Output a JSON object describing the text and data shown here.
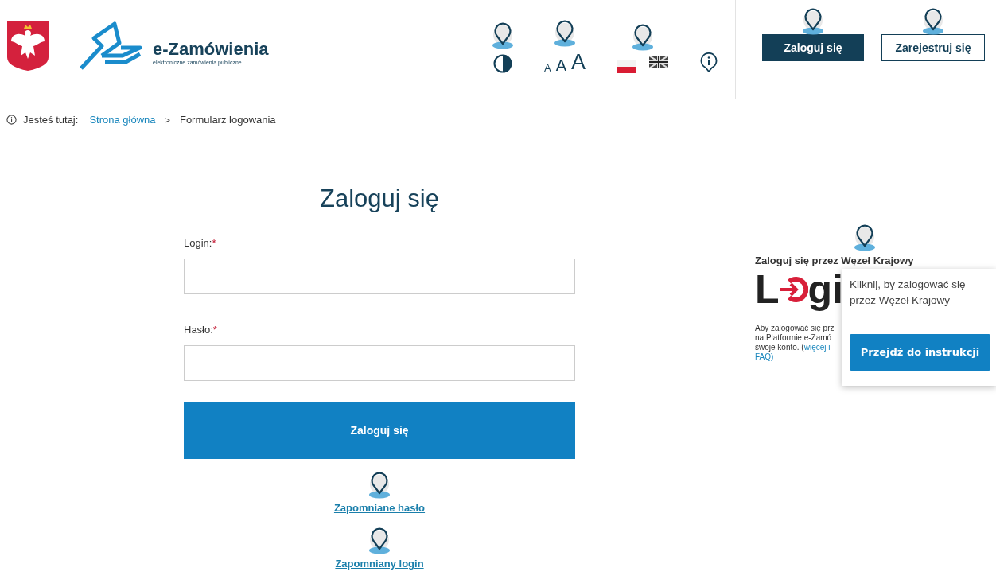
{
  "header": {
    "logo_title": "e-Zamówienia",
    "logo_subtitle": "elektroniczne zamówienia publiczne",
    "font_sizes": [
      "A",
      "A",
      "A"
    ],
    "languages": [
      {
        "kind": "pl"
      },
      {
        "kind": "en"
      }
    ],
    "buttons": [
      {
        "label": "Zaloguj się",
        "kind": "primary"
      },
      {
        "label": "Zarejestruj się",
        "kind": "outline"
      }
    ]
  },
  "breadcrumb": {
    "label": "Jesteś tutaj:",
    "separator": ">",
    "items": [
      {
        "label": "Strona główna",
        "kind": "link"
      },
      {
        "label": "Formularz logowania",
        "kind": "current"
      }
    ]
  },
  "form": {
    "title": "Zaloguj się",
    "fields": [
      {
        "label": "Login:",
        "required_mark": "*"
      },
      {
        "label": "Hasło:",
        "required_mark": "*"
      }
    ],
    "submit": "Zaloguj się",
    "links": [
      "Zapomniane hasło",
      "Zapomniany login"
    ]
  },
  "side": {
    "title": "Zaloguj się przez Węzeł Krajowy",
    "logo": {
      "before": "L",
      "after": "gi"
    },
    "lines": [
      [
        {
          "kind": "text",
          "text": "Aby zalogować się prz"
        }
      ],
      [
        {
          "kind": "text",
          "text": "na Platformie e-Zamó"
        }
      ],
      [
        {
          "kind": "text",
          "text": "swoje konto. ("
        },
        {
          "kind": "link",
          "text": "więcej i"
        }
      ],
      [
        {
          "kind": "link",
          "text": "FAQ)"
        }
      ]
    ]
  },
  "tooltip": {
    "text": "Kliknij, by zalogować się przez Węzeł Krajowy",
    "button": "Przejdź do instrukcji"
  }
}
